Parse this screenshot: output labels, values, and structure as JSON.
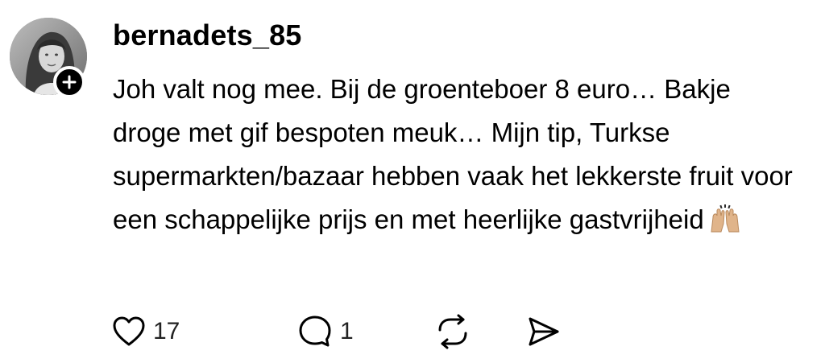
{
  "post": {
    "username": "bernadets_85",
    "text": "Joh valt nog mee. Bij de groenteboer 8 euro… Bakje droge met gif bespoten meuk… Mijn tip, Turkse supermarkten/bazaar hebben vaak het lekkerste fruit voor een schappelijke prijs en met heerlijke gastvrijheid",
    "emoji": "raising-hands-light-medium-skin-tone",
    "avatar_icon": "profile-photo",
    "follow_icon": "plus-icon"
  },
  "actions": {
    "like": {
      "icon": "heart-icon",
      "count": "17"
    },
    "reply": {
      "icon": "comment-icon",
      "count": "1"
    },
    "repost": {
      "icon": "repost-icon"
    },
    "share": {
      "icon": "send-icon"
    }
  },
  "colors": {
    "text": "#000000",
    "badge": "#000000",
    "emoji_skin": "#e0b48a"
  }
}
